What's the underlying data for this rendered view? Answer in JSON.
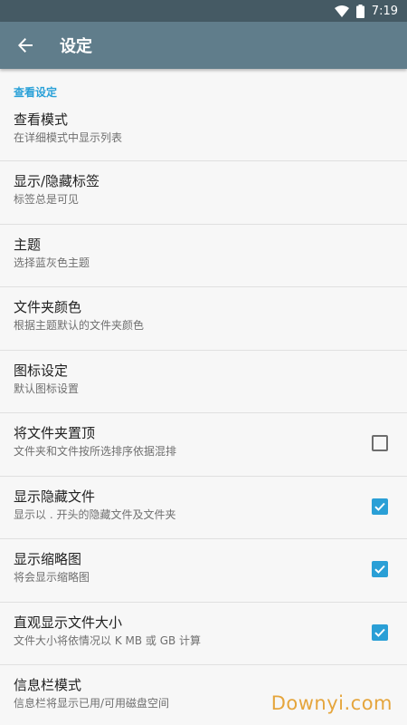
{
  "status_bar": {
    "time": "7:19"
  },
  "toolbar": {
    "title": "设定"
  },
  "section": {
    "title": "查看设定"
  },
  "prefs": [
    {
      "title": "查看模式",
      "summary": "在详细模式中显示列表"
    },
    {
      "title": "显示/隐藏标签",
      "summary": "标签总是可见"
    },
    {
      "title": "主题",
      "summary": "选择蓝灰色主题"
    },
    {
      "title": "文件夹颜色",
      "summary": "根据主题默认的文件夹颜色"
    },
    {
      "title": "图标设定",
      "summary": "默认图标设置"
    },
    {
      "title": "将文件夹置顶",
      "summary": "文件夹和文件按所选排序依据混排",
      "checked": false
    },
    {
      "title": "显示隐藏文件",
      "summary": "显示以 . 开头的隐藏文件及文件夹",
      "checked": true
    },
    {
      "title": "显示缩略图",
      "summary": "将会显示缩略图",
      "checked": true
    },
    {
      "title": "直观显示文件大小",
      "summary": "文件大小将依情况以 K MB 或 GB 计算",
      "checked": true
    },
    {
      "title": "信息栏模式",
      "summary": "信息栏将显示已用/可用磁盘空间"
    }
  ],
  "watermark": "Downyi.com",
  "colors": {
    "status_bar": "#455a64",
    "toolbar": "#607d8b",
    "accent": "#2aa1d8"
  }
}
